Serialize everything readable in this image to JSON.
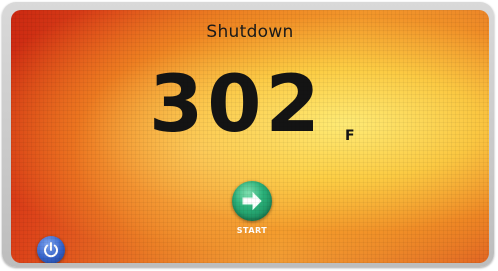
{
  "screen": {
    "title": "Shutdown",
    "temperature": {
      "value": "302",
      "unit": "F"
    },
    "start_button": {
      "label": "START",
      "icon": "arrow-right-icon",
      "color": "#2bb27a"
    },
    "power_button": {
      "icon": "power-icon",
      "color": "#3462c9"
    }
  }
}
